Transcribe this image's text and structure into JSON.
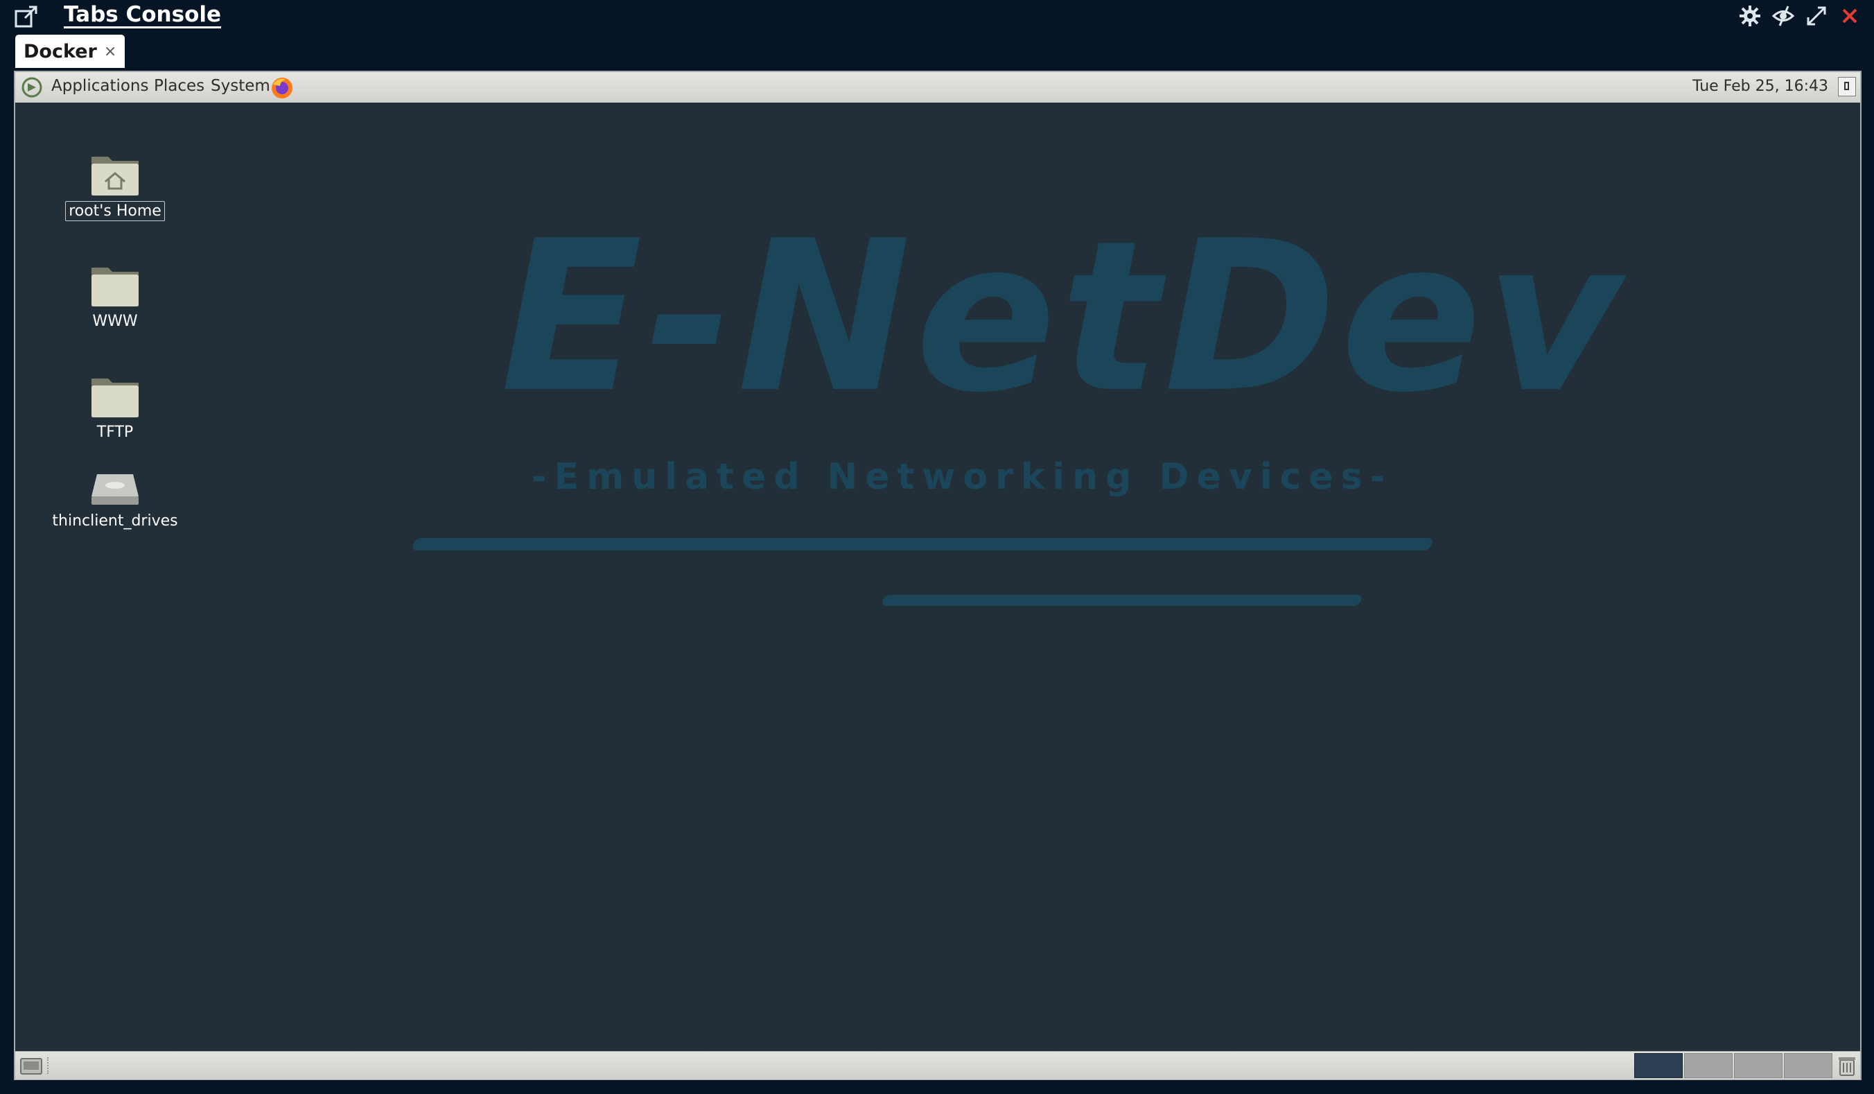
{
  "window": {
    "title": "Tabs Console",
    "icons": [
      "popout-icon",
      "settings-gear-icon",
      "eye-hide-icon",
      "fullscreen-icon",
      "close-icon"
    ],
    "close_color": "#e03c31"
  },
  "tabs": [
    {
      "label": "Docker",
      "close": "×"
    }
  ],
  "top_panel": {
    "menus": [
      "Applications",
      "Places",
      "System"
    ],
    "clock": "Tue Feb 25, 16:43"
  },
  "desktop": {
    "icons": [
      {
        "label": "root's Home",
        "icon": "home-folder-icon",
        "selected": true
      },
      {
        "label": "WWW",
        "icon": "folder-icon"
      },
      {
        "label": "TFTP",
        "icon": "folder-icon"
      },
      {
        "label": "thinclient_drives",
        "icon": "drive-icon"
      }
    ],
    "wallpaper": {
      "title": "E-NetDev",
      "subtitle": "-Emulated Networking Devices-",
      "color": "#1b4558"
    },
    "background": "#232f38"
  },
  "bottom_panel": {
    "workspaces": 4,
    "active_workspace": 1
  }
}
